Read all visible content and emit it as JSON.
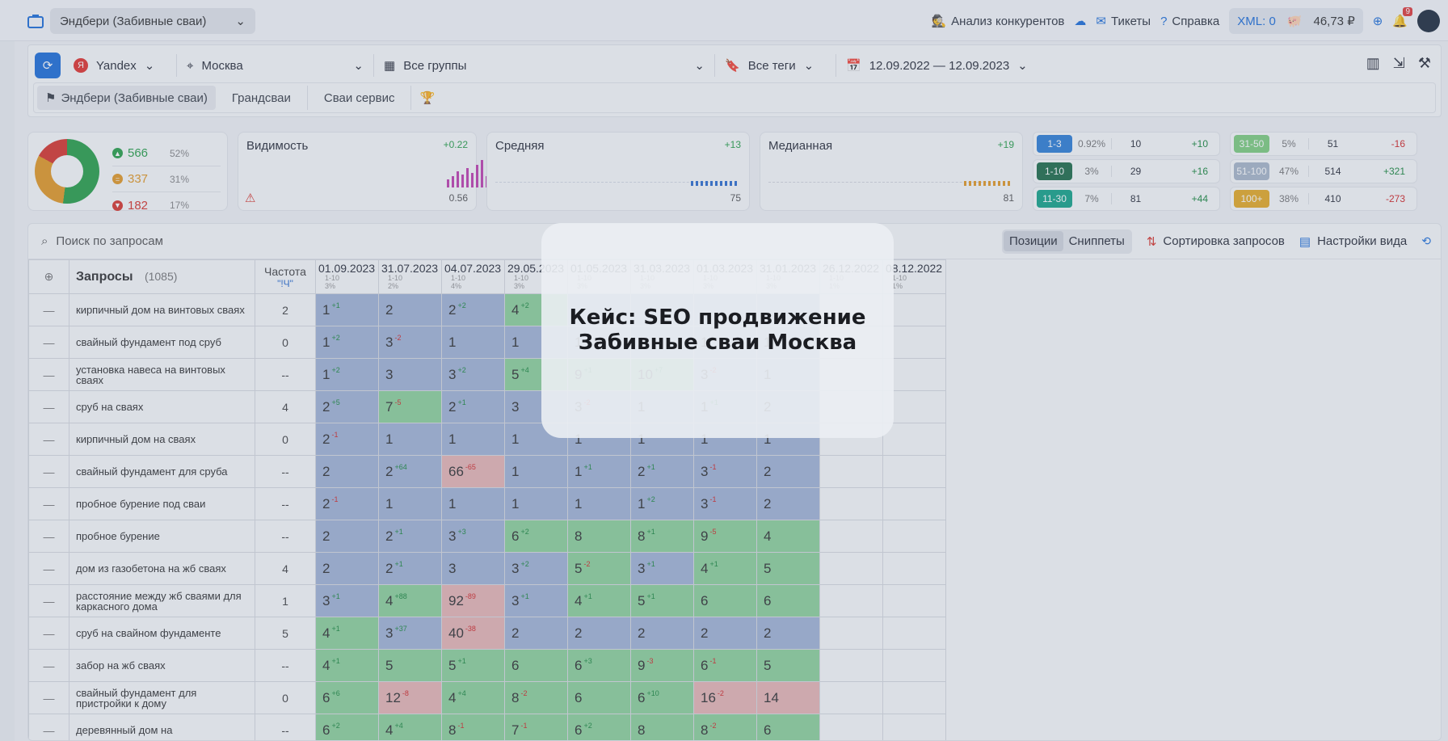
{
  "topbar": {
    "project": "Эндбери (Забивные сваи)",
    "competitors": "Анализ конкурентов",
    "tickets": "Тикеты",
    "help": "Справка",
    "xml": "XML: 0",
    "balance": "46,73 ₽",
    "notif_count": "9"
  },
  "filters": {
    "engine": "Yandex",
    "region": "Москва",
    "groups": "Все группы",
    "tags": "Все теги",
    "dates": "12.09.2022 — 12.09.2023"
  },
  "tabs": [
    "Эндбери (Забивные сваи)",
    "Грандсваи",
    "Сваи сервис"
  ],
  "summary": {
    "up": {
      "count": "566",
      "pct": "52%"
    },
    "same": {
      "count": "337",
      "pct": "31%"
    },
    "down": {
      "count": "182",
      "pct": "17%"
    }
  },
  "metrics": [
    {
      "label": "Видимость",
      "delta": "+0.22",
      "value": "0.56"
    },
    {
      "label": "Средняя",
      "delta": "+13",
      "value": "75"
    },
    {
      "label": "Медианная",
      "delta": "+19",
      "value": "81"
    }
  ],
  "ranges": [
    [
      {
        "label": "1-3",
        "pct": "0.92%",
        "count": "10",
        "delta": "+10",
        "color": "#2f7fd6"
      },
      {
        "label": "1-10",
        "pct": "3%",
        "count": "29",
        "delta": "+16",
        "color": "#1f6e4a"
      },
      {
        "label": "11-30",
        "pct": "7%",
        "count": "81",
        "delta": "+44",
        "color": "#17a58a"
      }
    ],
    [
      {
        "label": "31-50",
        "pct": "5%",
        "count": "51",
        "delta": "-16",
        "color": "#7fcf7f"
      },
      {
        "label": "51-100",
        "pct": "47%",
        "count": "514",
        "delta": "+321",
        "color": "#a9b8c9"
      },
      {
        "label": "100+",
        "pct": "38%",
        "count": "410",
        "delta": "-273",
        "color": "#e7ab24"
      }
    ]
  ],
  "toolbar": {
    "search_placeholder": "Поиск по запросам",
    "positions": "Позиции",
    "snippets": "Сниппеты",
    "sort": "Сортировка запросов",
    "view": "Настройки вида"
  },
  "table": {
    "queries_label": "Запросы",
    "queries_count": "(1085)",
    "freq_label": "Частота",
    "freq_sub": "\"!Ч\"",
    "dates": [
      {
        "d": "01.09.2023",
        "r": "1-10",
        "p": "3%"
      },
      {
        "d": "31.07.2023",
        "r": "1-10",
        "p": "2%"
      },
      {
        "d": "04.07.2023",
        "r": "1-10",
        "p": "4%"
      },
      {
        "d": "29.05.2023",
        "r": "1-10",
        "p": "3%"
      },
      {
        "d": "01.05.2023",
        "r": "1-10",
        "p": "3%"
      },
      {
        "d": "31.03.2023",
        "r": "1-10",
        "p": "3%"
      },
      {
        "d": "01.03.2023",
        "r": "1-10",
        "p": "3%"
      },
      {
        "d": "31.01.2023",
        "r": "1-10",
        "p": "3%"
      },
      {
        "d": "26.12.2022",
        "r": "1-10",
        "p": "1%"
      },
      {
        "d": "08.12.2022",
        "r": "1-10",
        "p": "1%"
      }
    ],
    "rows": [
      {
        "q": "кирпичный дом на винтовых сваях",
        "f": "2",
        "c": [
          [
            "1",
            "+1",
            "b"
          ],
          [
            "2",
            "",
            "b"
          ],
          [
            "2",
            "+2",
            "b"
          ],
          [
            "4",
            "+2",
            "g"
          ],
          [
            "",
            "",
            "b"
          ],
          [
            "",
            "",
            "b"
          ],
          [
            "",
            "",
            "b"
          ],
          [
            "",
            "",
            "b"
          ],
          [
            "",
            "",
            "e"
          ],
          [
            "",
            "",
            "e"
          ]
        ]
      },
      {
        "q": "свайный фундамент под сруб",
        "f": "0",
        "c": [
          [
            "1",
            "+2",
            "b"
          ],
          [
            "3",
            "-2",
            "b"
          ],
          [
            "1",
            "",
            "b"
          ],
          [
            "1",
            "",
            "b"
          ],
          [
            "1",
            "",
            "b"
          ],
          [
            "1",
            "",
            "b"
          ],
          [
            "1",
            "",
            "b"
          ],
          [
            "1",
            "",
            "b"
          ],
          [
            "",
            "",
            "e"
          ],
          [
            "",
            "",
            "e"
          ]
        ]
      },
      {
        "q": "установка навеса на винтовых сваях",
        "f": "--",
        "c": [
          [
            "1",
            "+2",
            "b"
          ],
          [
            "3",
            "",
            "b"
          ],
          [
            "3",
            "+2",
            "b"
          ],
          [
            "5",
            "+4",
            "g"
          ],
          [
            "9",
            "+1",
            "g"
          ],
          [
            "10",
            "+7",
            "g"
          ],
          [
            "3",
            "-2",
            "b"
          ],
          [
            "1",
            "",
            "b"
          ],
          [
            "",
            "",
            "e"
          ],
          [
            "",
            "",
            "e"
          ]
        ]
      },
      {
        "q": "сруб на сваях",
        "f": "4",
        "c": [
          [
            "2",
            "+5",
            "b"
          ],
          [
            "7",
            "-5",
            "g"
          ],
          [
            "2",
            "+1",
            "b"
          ],
          [
            "3",
            "",
            "b"
          ],
          [
            "3",
            "-2",
            "b"
          ],
          [
            "1",
            "",
            "b"
          ],
          [
            "1",
            "+1",
            "b"
          ],
          [
            "2",
            "",
            "b"
          ],
          [
            "",
            "",
            "e"
          ],
          [
            "",
            "",
            "e"
          ]
        ]
      },
      {
        "q": "кирпичный дом на сваях",
        "f": "0",
        "c": [
          [
            "2",
            "-1",
            "b"
          ],
          [
            "1",
            "",
            "b"
          ],
          [
            "1",
            "",
            "b"
          ],
          [
            "1",
            "",
            "b"
          ],
          [
            "1",
            "",
            "b"
          ],
          [
            "1",
            "",
            "b"
          ],
          [
            "1",
            "",
            "b"
          ],
          [
            "1",
            "",
            "b"
          ],
          [
            "",
            "",
            "e"
          ],
          [
            "",
            "",
            "e"
          ]
        ]
      },
      {
        "q": "свайный фундамент для сруба",
        "f": "--",
        "c": [
          [
            "2",
            "",
            "b"
          ],
          [
            "2",
            "+64",
            "b"
          ],
          [
            "66",
            "-65",
            "r"
          ],
          [
            "1",
            "",
            "b"
          ],
          [
            "1",
            "+1",
            "b"
          ],
          [
            "2",
            "+1",
            "b"
          ],
          [
            "3",
            "-1",
            "b"
          ],
          [
            "2",
            "",
            "b"
          ],
          [
            "",
            "",
            "e"
          ],
          [
            "",
            "",
            "e"
          ]
        ]
      },
      {
        "q": "пробное бурение под сваи",
        "f": "--",
        "c": [
          [
            "2",
            "-1",
            "b"
          ],
          [
            "1",
            "",
            "b"
          ],
          [
            "1",
            "",
            "b"
          ],
          [
            "1",
            "",
            "b"
          ],
          [
            "1",
            "",
            "b"
          ],
          [
            "1",
            "+2",
            "b"
          ],
          [
            "3",
            "-1",
            "b"
          ],
          [
            "2",
            "",
            "b"
          ],
          [
            "",
            "",
            "e"
          ],
          [
            "",
            "",
            "e"
          ]
        ]
      },
      {
        "q": "пробное бурение",
        "f": "--",
        "c": [
          [
            "2",
            "",
            "b"
          ],
          [
            "2",
            "+1",
            "b"
          ],
          [
            "3",
            "+3",
            "b"
          ],
          [
            "6",
            "+2",
            "g"
          ],
          [
            "8",
            "",
            "g"
          ],
          [
            "8",
            "+1",
            "g"
          ],
          [
            "9",
            "-5",
            "g"
          ],
          [
            "4",
            "",
            "g"
          ],
          [
            "",
            "",
            "e"
          ],
          [
            "",
            "",
            "e"
          ]
        ]
      },
      {
        "q": "дом из газобетона на жб сваях",
        "f": "4",
        "c": [
          [
            "2",
            "",
            "b"
          ],
          [
            "2",
            "+1",
            "b"
          ],
          [
            "3",
            "",
            "b"
          ],
          [
            "3",
            "+2",
            "b"
          ],
          [
            "5",
            "-2",
            "g"
          ],
          [
            "3",
            "+1",
            "b"
          ],
          [
            "4",
            "+1",
            "g"
          ],
          [
            "5",
            "",
            "g"
          ],
          [
            "",
            "",
            "e"
          ],
          [
            "",
            "",
            "e"
          ]
        ]
      },
      {
        "q": "расстояние между жб сваями для каркасного дома",
        "f": "1",
        "c": [
          [
            "3",
            "+1",
            "b"
          ],
          [
            "4",
            "+88",
            "g"
          ],
          [
            "92",
            "-89",
            "r"
          ],
          [
            "3",
            "+1",
            "b"
          ],
          [
            "4",
            "+1",
            "g"
          ],
          [
            "5",
            "+1",
            "g"
          ],
          [
            "6",
            "",
            "g"
          ],
          [
            "6",
            "",
            "g"
          ],
          [
            "",
            "",
            "e"
          ],
          [
            "",
            "",
            "e"
          ]
        ]
      },
      {
        "q": "сруб на свайном фундаменте",
        "f": "5",
        "c": [
          [
            "4",
            "+1",
            "g"
          ],
          [
            "3",
            "+37",
            "b"
          ],
          [
            "40",
            "-38",
            "r"
          ],
          [
            "2",
            "",
            "b"
          ],
          [
            "2",
            "",
            "b"
          ],
          [
            "2",
            "",
            "b"
          ],
          [
            "2",
            "",
            "b"
          ],
          [
            "2",
            "",
            "b"
          ],
          [
            "",
            "",
            "e"
          ],
          [
            "",
            "",
            "e"
          ]
        ]
      },
      {
        "q": "забор на жб сваях",
        "f": "--",
        "c": [
          [
            "4",
            "+1",
            "g"
          ],
          [
            "5",
            "",
            "g"
          ],
          [
            "5",
            "+1",
            "g"
          ],
          [
            "6",
            "",
            "g"
          ],
          [
            "6",
            "+3",
            "g"
          ],
          [
            "9",
            "-3",
            "g"
          ],
          [
            "6",
            "-1",
            "g"
          ],
          [
            "5",
            "",
            "g"
          ],
          [
            "",
            "",
            "e"
          ],
          [
            "",
            "",
            "e"
          ]
        ]
      },
      {
        "q": "свайный фундамент для пристройки к дому",
        "f": "0",
        "c": [
          [
            "6",
            "+6",
            "g"
          ],
          [
            "12",
            "-8",
            "r"
          ],
          [
            "4",
            "+4",
            "g"
          ],
          [
            "8",
            "-2",
            "g"
          ],
          [
            "6",
            "",
            "g"
          ],
          [
            "6",
            "+10",
            "g"
          ],
          [
            "16",
            "-2",
            "r"
          ],
          [
            "14",
            "",
            "r"
          ],
          [
            "",
            "",
            "e"
          ],
          [
            "",
            "",
            "e"
          ]
        ]
      },
      {
        "q": "деревянный дом на",
        "f": "--",
        "c": [
          [
            "6",
            "+2",
            "g"
          ],
          [
            "4",
            "+4",
            "g"
          ],
          [
            "8",
            "-1",
            "g"
          ],
          [
            "7",
            "-1",
            "g"
          ],
          [
            "6",
            "+2",
            "g"
          ],
          [
            "8",
            "",
            "g"
          ],
          [
            "8",
            "-2",
            "g"
          ],
          [
            "6",
            "",
            "g"
          ],
          [
            "",
            "",
            "e"
          ],
          [
            "",
            "",
            "e"
          ]
        ]
      }
    ]
  },
  "overlay": {
    "line1": "Кейс: SEO продвижение",
    "line2": "Забивные сваи Москва"
  }
}
